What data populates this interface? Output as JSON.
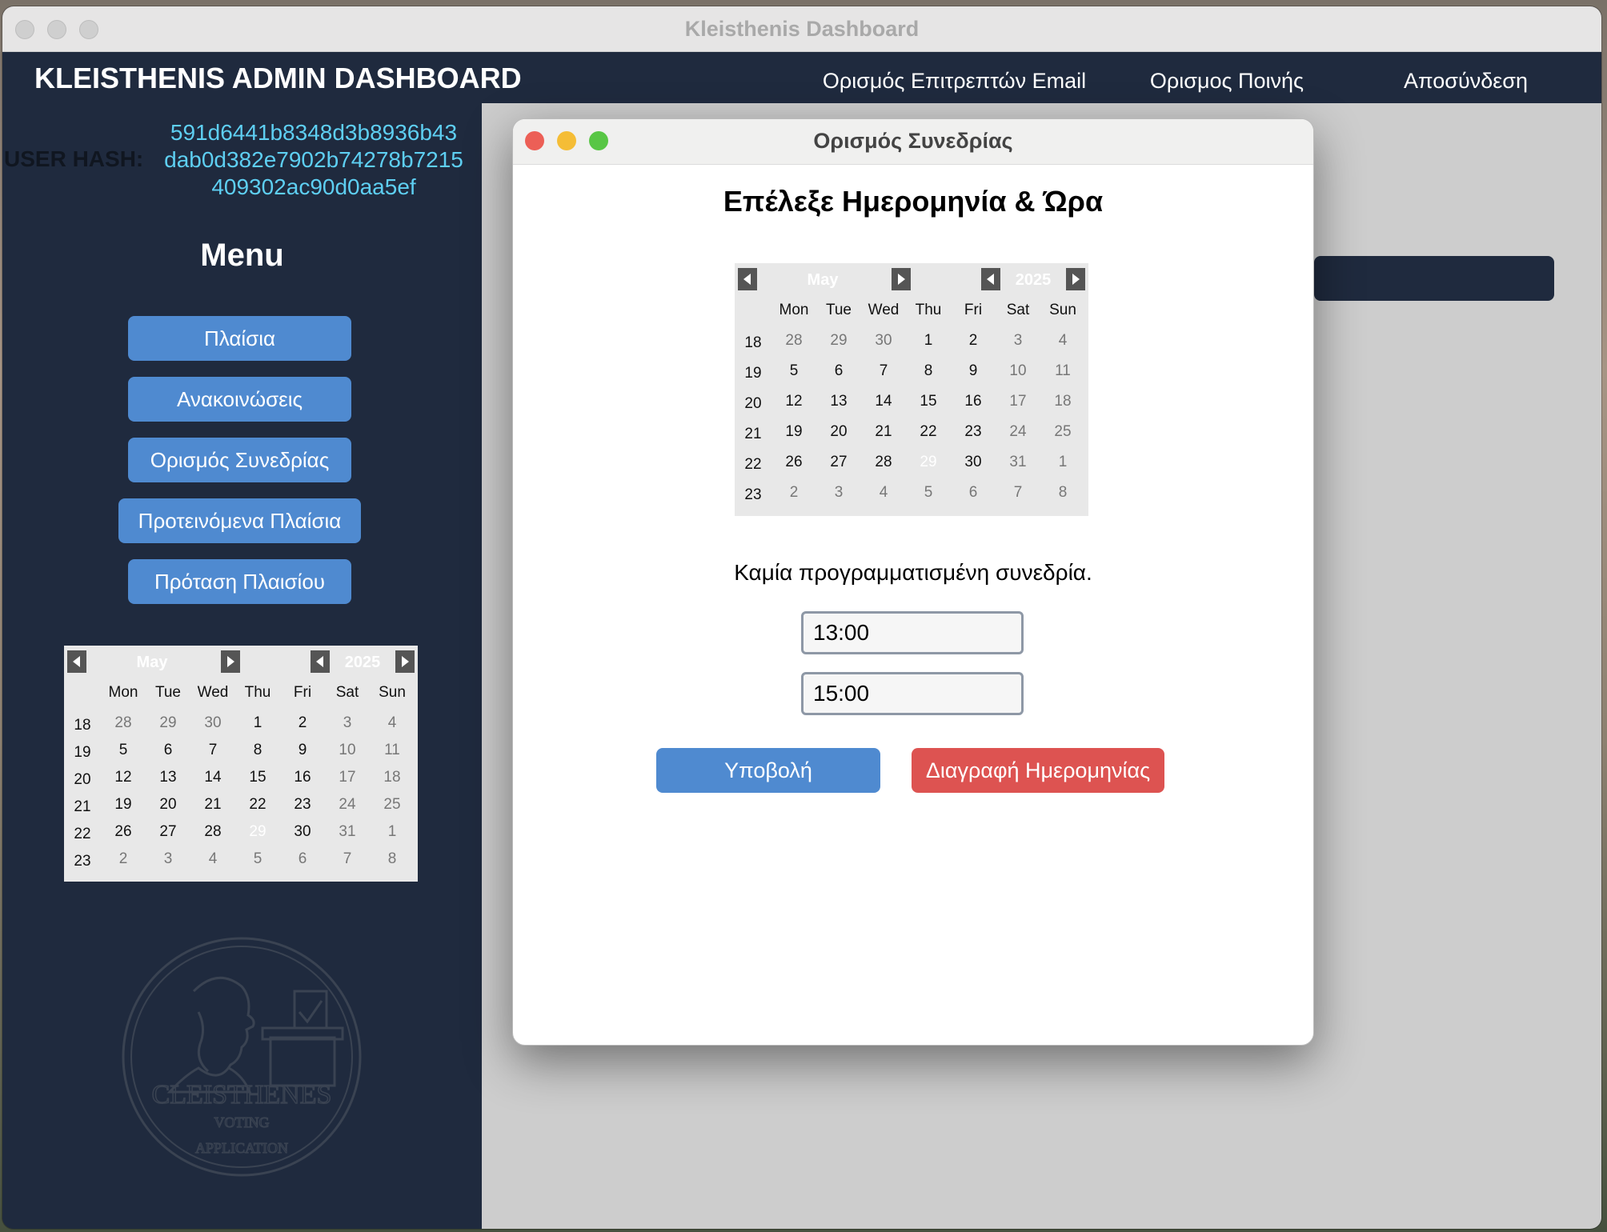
{
  "window": {
    "title": "Kleisthenis Dashboard"
  },
  "header": {
    "app_title": "KLEISTHENIS ADMIN DASHBOARD",
    "buttons": [
      {
        "label": "Ορισμός Επιτρεπτών Email",
        "color": "#5cb585"
      },
      {
        "label": "Ορισμος Ποινής",
        "color": "#7537e0"
      },
      {
        "label": "Αποσύνδεση",
        "color": "#dd5351"
      }
    ]
  },
  "sidebar": {
    "hash_label": "USER HASH:",
    "hash_lines": [
      "591d6441b8348d3b8936b43",
      "dab0d382e7902b74278b7215",
      "409302ac90d0aa5ef"
    ],
    "menu_title": "Menu",
    "menu_items": [
      {
        "label": "Πλαίσια"
      },
      {
        "label": "Ανακοινώσεις"
      },
      {
        "label": "Ορισμός Συνεδρίας"
      },
      {
        "label": "Προτεινόμενα Πλαίσια"
      },
      {
        "label": "Πρόταση Πλαισίου"
      }
    ]
  },
  "calendar": {
    "month": "May",
    "year": "2025",
    "weekdays": [
      "Mon",
      "Tue",
      "Wed",
      "Thu",
      "Fri",
      "Sat",
      "Sun"
    ],
    "weeks": [
      {
        "num": "18",
        "days": [
          "28",
          "29",
          "30",
          "1",
          "2",
          "3",
          "4"
        ]
      },
      {
        "num": "19",
        "days": [
          "5",
          "6",
          "7",
          "8",
          "9",
          "10",
          "11"
        ]
      },
      {
        "num": "20",
        "days": [
          "12",
          "13",
          "14",
          "15",
          "16",
          "17",
          "18"
        ]
      },
      {
        "num": "21",
        "days": [
          "19",
          "20",
          "21",
          "22",
          "23",
          "24",
          "25"
        ]
      },
      {
        "num": "22",
        "days": [
          "26",
          "27",
          "28",
          "29",
          "30",
          "31",
          "1"
        ]
      },
      {
        "num": "23",
        "days": [
          "2",
          "3",
          "4",
          "5",
          "6",
          "7",
          "8"
        ]
      }
    ],
    "selected_day": "29"
  },
  "logo": {
    "name": "CLEISTHENES",
    "line2": "VOTING",
    "line3": "APPLICATION"
  },
  "dialog": {
    "title": "Ορισμός Συνεδρίας",
    "heading": "Επέλεξε Ημερομηνία & Ώρα",
    "status": "Καμία προγραμματισμένη συνεδρία.",
    "start_time": "13:00",
    "end_time": "15:00",
    "submit_label": "Υποβολή",
    "delete_label": "Διαγραφή Ημερομηνίας",
    "submit_color": "#4f8ad0",
    "delete_color": "#dd5351"
  }
}
